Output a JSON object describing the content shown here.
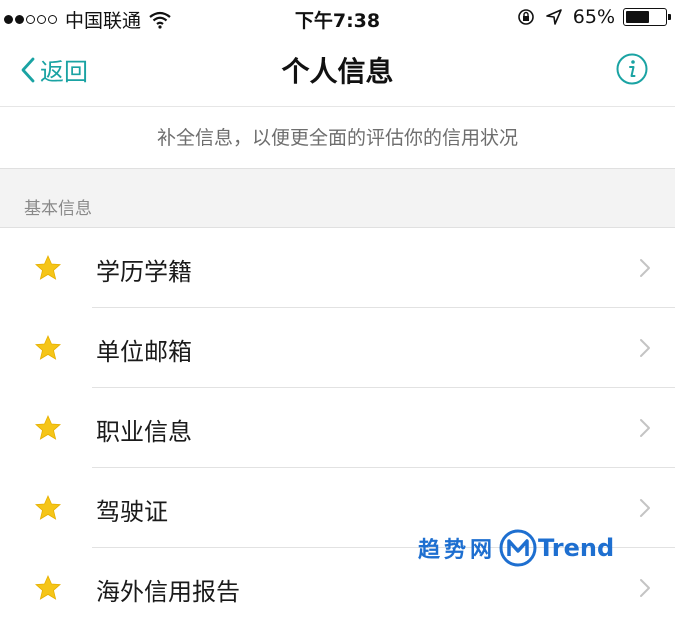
{
  "status_bar": {
    "carrier": "中国联通",
    "time": "下午7:38",
    "battery_percent": "65%",
    "battery_level": 0.65,
    "signal_full": 2,
    "signal_total": 5
  },
  "nav": {
    "back_label": "返回",
    "title": "个人信息"
  },
  "tip": "补全信息，以便更全面的评估你的信用状况",
  "section": {
    "header": "基本信息",
    "items": [
      {
        "label": "学历学籍"
      },
      {
        "label": "单位邮箱"
      },
      {
        "label": "职业信息"
      },
      {
        "label": "驾驶证"
      },
      {
        "label": "海外信用报告"
      }
    ]
  },
  "watermark": {
    "text": "趋势网",
    "brand": "Trend"
  },
  "colors": {
    "accent": "#1aa3a3",
    "star": "#f5c518",
    "watermark": "#1e6fd0"
  }
}
